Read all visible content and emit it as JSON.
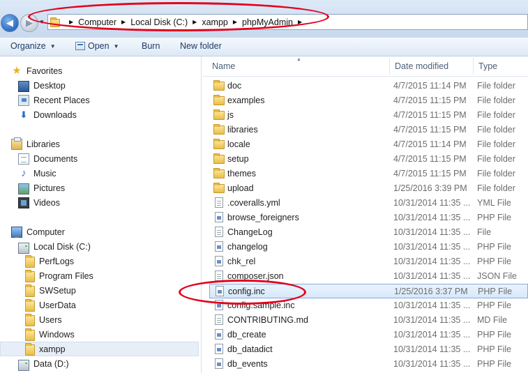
{
  "addressbar": {
    "breadcrumbs": [
      "Computer",
      "Local Disk (C:)",
      "xampp",
      "phpMyAdmin"
    ]
  },
  "toolbar": {
    "organize_label": "Organize",
    "open_label": "Open",
    "burn_label": "Burn",
    "new_folder_label": "New folder"
  },
  "navpane": {
    "favorites": {
      "label": "Favorites",
      "items": [
        "Desktop",
        "Recent Places",
        "Downloads"
      ]
    },
    "libraries": {
      "label": "Libraries",
      "items": [
        "Documents",
        "Music",
        "Pictures",
        "Videos"
      ]
    },
    "computer": {
      "label": "Computer",
      "drive_c": "Local Disk (C:)",
      "folders": [
        "PerfLogs",
        "Program Files",
        "SWSetup",
        "UserData",
        "Users",
        "Windows",
        "xampp"
      ],
      "drive_d": "Data (D:)"
    }
  },
  "columns": {
    "name": "Name",
    "date_modified": "Date modified",
    "type": "Type"
  },
  "files": [
    {
      "name": "doc",
      "date": "4/7/2015 11:14 PM",
      "type": "File folder",
      "icon": "folder-icon"
    },
    {
      "name": "examples",
      "date": "4/7/2015 11:15 PM",
      "type": "File folder",
      "icon": "folder-icon"
    },
    {
      "name": "js",
      "date": "4/7/2015 11:15 PM",
      "type": "File folder",
      "icon": "folder-icon"
    },
    {
      "name": "libraries",
      "date": "4/7/2015 11:15 PM",
      "type": "File folder",
      "icon": "folder-icon"
    },
    {
      "name": "locale",
      "date": "4/7/2015 11:14 PM",
      "type": "File folder",
      "icon": "folder-icon"
    },
    {
      "name": "setup",
      "date": "4/7/2015 11:15 PM",
      "type": "File folder",
      "icon": "folder-icon"
    },
    {
      "name": "themes",
      "date": "4/7/2015 11:15 PM",
      "type": "File folder",
      "icon": "folder-icon"
    },
    {
      "name": "upload",
      "date": "1/25/2016 3:39 PM",
      "type": "File folder",
      "icon": "folder-icon"
    },
    {
      "name": ".coveralls.yml",
      "date": "10/31/2014 11:35 ...",
      "type": "YML File",
      "icon": "yml-file-icon"
    },
    {
      "name": "browse_foreigners",
      "date": "10/31/2014 11:35 ...",
      "type": "PHP File",
      "icon": "php-file-icon"
    },
    {
      "name": "ChangeLog",
      "date": "10/31/2014 11:35 ...",
      "type": "File",
      "icon": "file-icon"
    },
    {
      "name": "changelog",
      "date": "10/31/2014 11:35 ...",
      "type": "PHP File",
      "icon": "php-file-icon"
    },
    {
      "name": "chk_rel",
      "date": "10/31/2014 11:35 ...",
      "type": "PHP File",
      "icon": "php-file-icon"
    },
    {
      "name": "composer.json",
      "date": "10/31/2014 11:35 ...",
      "type": "JSON File",
      "icon": "json-file-icon"
    },
    {
      "name": "config.inc",
      "date": "1/25/2016 3:37 PM",
      "type": "PHP File",
      "icon": "php-file-icon",
      "selected": true
    },
    {
      "name": "config.sample.inc",
      "date": "10/31/2014 11:35 ...",
      "type": "PHP File",
      "icon": "php-file-icon"
    },
    {
      "name": "CONTRIBUTING.md",
      "date": "10/31/2014 11:35 ...",
      "type": "MD File",
      "icon": "file-icon"
    },
    {
      "name": "db_create",
      "date": "10/31/2014 11:35 ...",
      "type": "PHP File",
      "icon": "php-file-icon"
    },
    {
      "name": "db_datadict",
      "date": "10/31/2014 11:35 ...",
      "type": "PHP File",
      "icon": "php-file-icon"
    },
    {
      "name": "db_events",
      "date": "10/31/2014 11:35 ...",
      "type": "PHP File",
      "icon": "php-file-icon"
    }
  ],
  "colors": {
    "annotation": "#e3001b",
    "selection_border": "#84acdd",
    "toolbar_text": "#1e3b66"
  }
}
